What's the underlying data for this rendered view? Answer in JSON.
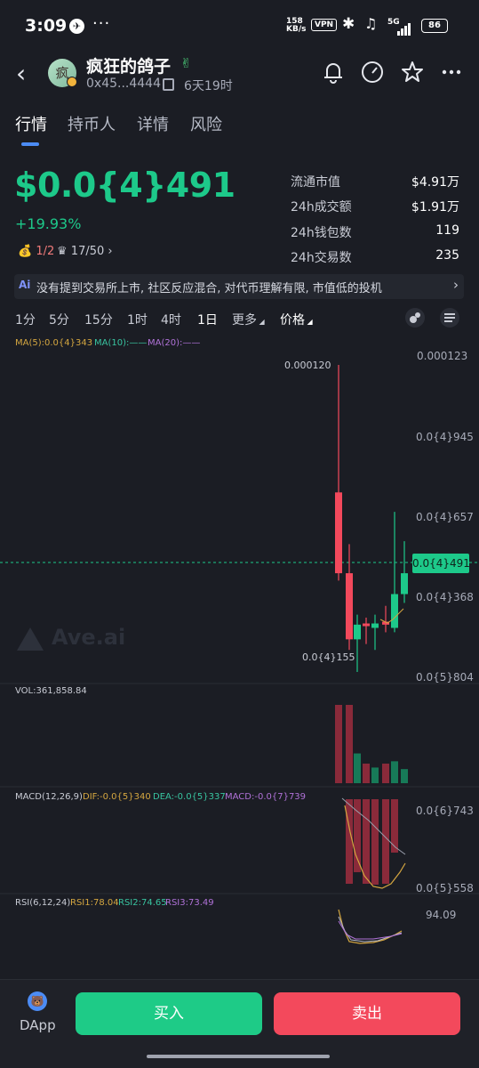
{
  "status_bar": {
    "time": "3:09",
    "dots": "···",
    "net_speed_value": "158",
    "net_speed_unit": "KB/s",
    "vpn": "VPN",
    "signal": "5G",
    "battery": "86"
  },
  "header": {
    "avatar_char": "疯",
    "token_name": "疯狂的鸽子",
    "address": "0x45...4444",
    "age": "6天19时"
  },
  "tabs": [
    "行情",
    "持币人",
    "详情",
    "风险"
  ],
  "price": {
    "value": "$0.0{4}491",
    "change": "+19.93%"
  },
  "badges": {
    "dev": "1/2",
    "holders": "17/50"
  },
  "stats": [
    {
      "label": "流通市值",
      "value": "$4.91万"
    },
    {
      "label": "24h成交额",
      "value": "$1.91万"
    },
    {
      "label": "24h钱包数",
      "value": "119"
    },
    {
      "label": "24h交易数",
      "value": "235"
    }
  ],
  "ai_banner": {
    "badge": "Ai",
    "text": "没有提到交易所上市, 社区反应混合, 对代币理解有限, 市值低的投机"
  },
  "timeframes": [
    "1分",
    "5分",
    "15分",
    "1时",
    "4时",
    "1日",
    "更多",
    "价格"
  ],
  "active_timeframe": "1日",
  "chart_data": {
    "type": "candlestick",
    "ma_legend": [
      "MA(5):0.0{4}343",
      "MA(10):——",
      "MA(20):——"
    ],
    "y_axis_labels": [
      "0.000123",
      "0.0{4}945",
      "0.0{4}657",
      "0.0{4}368",
      "0.0{5}804"
    ],
    "current_price_label": "0.0{4}491",
    "high_label": "0.000120",
    "low_label": "0.0{4}155",
    "candles": [
      {
        "open": 4.91e-05,
        "close": 7.66e-05,
        "high": 0.00012,
        "low": 4.66e-05,
        "dir": "down"
      },
      {
        "open": 4.91e-05,
        "close": 2.66e-05,
        "high": 5.9e-05,
        "low": 2.3e-05,
        "dir": "down"
      },
      {
        "open": 2.66e-05,
        "close": 3.16e-05,
        "high": 3.5e-05,
        "low": 1.55e-05,
        "dir": "up"
      },
      {
        "open": 3.16e-05,
        "close": 3.2e-05,
        "high": 3.4e-05,
        "low": 2.5e-05,
        "dir": "down"
      },
      {
        "open": 3.05e-05,
        "close": 3.2e-05,
        "high": 3.5e-05,
        "low": 2.3e-05,
        "dir": "up"
      },
      {
        "open": 3.16e-05,
        "close": 3.26e-05,
        "high": 3.8e-05,
        "low": 2.9e-05,
        "dir": "down"
      },
      {
        "open": 3.05e-05,
        "close": 4.2e-05,
        "high": 7e-05,
        "low": 2.9e-05,
        "dir": "up"
      },
      {
        "open": 4.2e-05,
        "close": 4.91e-05,
        "high": 6e-05,
        "low": 3.9e-05,
        "dir": "up"
      }
    ],
    "volume_label": "VOL:361,858.84",
    "volumes": [
      1.0,
      1.0,
      0.38,
      0.25,
      0.2,
      0.25,
      0.28,
      0.18
    ],
    "volume_dir": [
      "down",
      "down",
      "up",
      "down",
      "up",
      "down",
      "up",
      "up"
    ],
    "macd_legend": [
      "MACD(12,26,9)",
      "DIF:-0.0{5}340",
      "DEA:-0.0{5}337",
      "MACD:-0.0{7}739"
    ],
    "macd_axis": [
      "0.0{6}743",
      "0.0{5}558"
    ],
    "macd_hist": [
      0.0,
      0.95,
      0.82,
      0.95,
      0.96,
      0.95,
      0.6,
      0.0
    ],
    "rsi_legend": [
      "RSI(6,12,24)",
      "RSI1:78.04",
      "RSI2:74.65",
      "RSI3:73.49"
    ],
    "rsi_axis": [
      "94.09"
    ],
    "watermark": "Ave.ai"
  },
  "colors": {
    "up": "#1dc98a",
    "down": "#f3495c",
    "background": "#1b1d24",
    "accent": "#4c8cf5"
  },
  "bottom": {
    "dapp": "DApp",
    "buy": "买入",
    "sell": "卖出"
  }
}
